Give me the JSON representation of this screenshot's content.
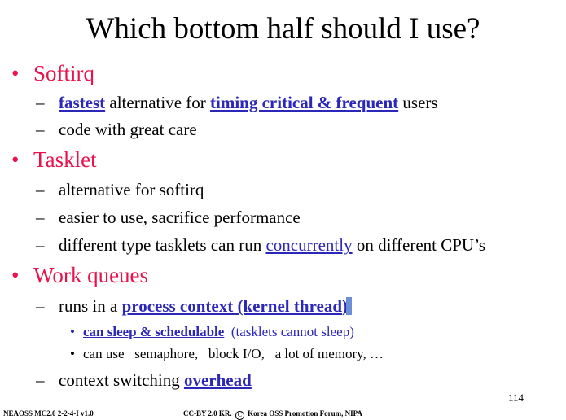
{
  "slide": {
    "title": "Which bottom half should I use?",
    "page_number": "114",
    "footer_left": "NEAOSS MC2.0 2-2-4-I v1.0",
    "footer_cc_prefix": "CC-BY 2.0 KR.",
    "footer_cc_symbol": "C",
    "footer_cc_suffix": "Korea OSS Promotion Forum, NIPA"
  },
  "bullets": {
    "softirq": {
      "label": "Softirq",
      "sub1": {
        "a": "fastest",
        "b": " alternative for ",
        "c": "timing critical & frequent",
        "d": " users"
      },
      "sub2": "code with great care"
    },
    "tasklet": {
      "label": "Tasklet",
      "sub1": "alternative for softirq",
      "sub2": "easier to use, sacrifice performance",
      "sub3": {
        "a": "different type tasklets can run ",
        "b": "concurrently",
        "c": " on different CPU’s"
      }
    },
    "workqueues": {
      "label": "Work queues",
      "sub1": {
        "a": "runs in a ",
        "b": "process context (kernel thread",
        "c": ")"
      },
      "sub1a": {
        "a": "can sleep & schedulable",
        "b": "  (tasklets cannot sleep)"
      },
      "sub1b": "can use   semaphore,   block I/O,   a lot of memory, …",
      "sub2": {
        "a": "context switching ",
        "b": "overhead"
      }
    }
  },
  "symbols": {
    "bullet": "•",
    "dash": "–",
    "small_bullet": "•"
  },
  "colors": {
    "heading_red": "#e8134c",
    "link_blue": "#2b27b8"
  }
}
